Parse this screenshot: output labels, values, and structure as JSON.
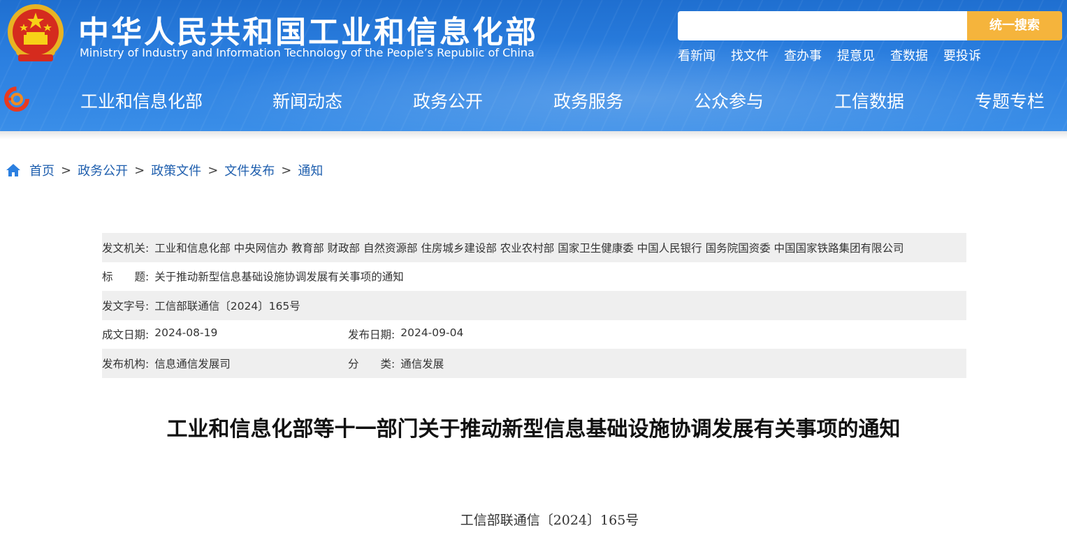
{
  "header": {
    "title_cn": "中华人民共和国工业和信息化部",
    "title_en": "Ministry of Industry and Information Technology of the People’s Republic of China",
    "search": {
      "placeholder": "",
      "button_label": "统一搜索"
    },
    "quick_links": [
      "看新闻",
      "找文件",
      "查办事",
      "提意见",
      "查数据",
      "要投诉"
    ],
    "nav": [
      "工业和信息化部",
      "新闻动态",
      "政务公开",
      "政务服务",
      "公众参与",
      "工信数据",
      "专题专栏"
    ],
    "colors": {
      "header_blue": "#2b7fe0",
      "search_button": "#f5b43c"
    }
  },
  "breadcrumb": {
    "home_icon": "home-icon",
    "items": [
      "首页",
      "政务公开",
      "政策文件",
      "文件发布",
      "通知"
    ],
    "separator": ">"
  },
  "info": {
    "issuer_label": "发文机关:",
    "issuer": "工业和信息化部 中央网信办 教育部 财政部 自然资源部 住房城乡建设部 农业农村部 国家卫生健康委 中国人民银行 国务院国资委 中国国家铁路集团有限公司",
    "title_label": "标　　题:",
    "title": "关于推动新型信息基础设施协调发展有关事项的通知",
    "doc_no_label": "发文字号:",
    "doc_no": "工信部联通信〔2024〕165号",
    "written_date_label": "成文日期:",
    "written_date": "2024-08-19",
    "publish_date_label": "发布日期:",
    "publish_date": "2024-09-04",
    "publisher_label": "发布机构:",
    "publisher": "信息通信发展司",
    "category_label": "分　　类:",
    "category": "通信发展"
  },
  "document": {
    "title": "工业和信息化部等十一部门关于推动新型信息基础设施协调发展有关事项的通知",
    "number": "工信部联通信〔2024〕165号"
  }
}
